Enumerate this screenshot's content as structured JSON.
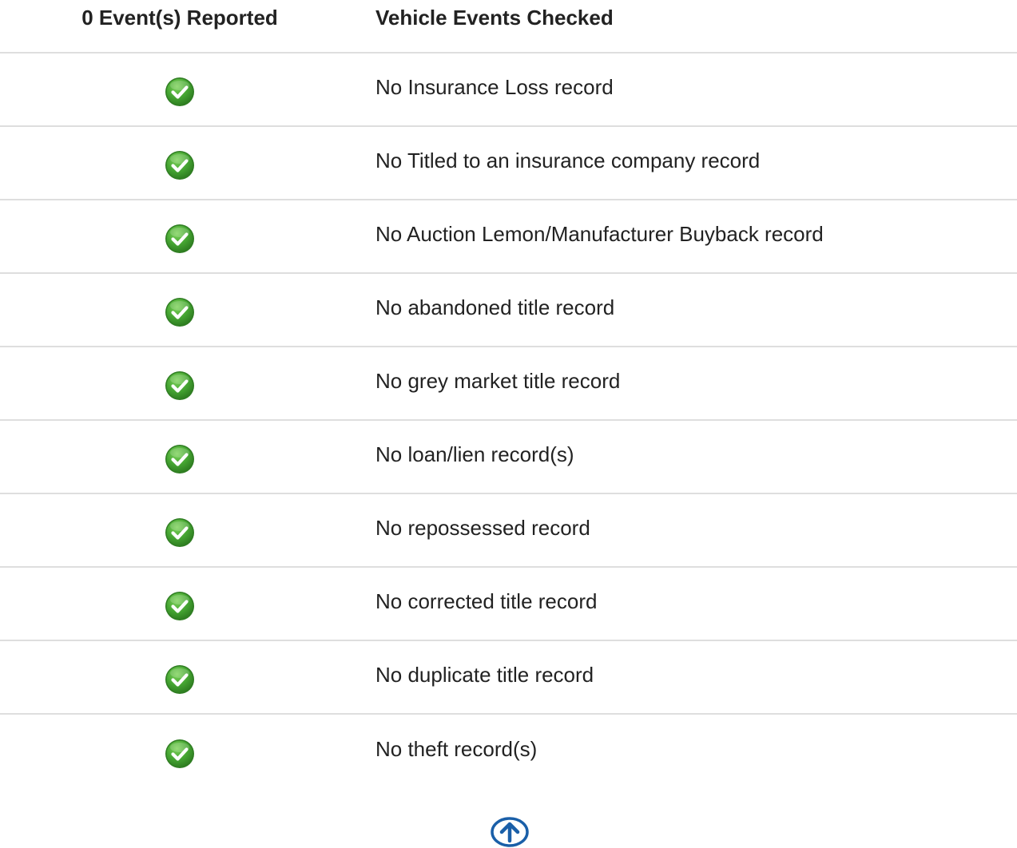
{
  "header": {
    "status_col": "0 Event(s) Reported",
    "event_col": "Vehicle Events Checked"
  },
  "rows": [
    {
      "status_icon": "green-check-icon",
      "label": "No Insurance Loss record"
    },
    {
      "status_icon": "green-check-icon",
      "label": "No Titled to an insurance company record"
    },
    {
      "status_icon": "green-check-icon",
      "label": "No Auction Lemon/Manufacturer Buyback record"
    },
    {
      "status_icon": "green-check-icon",
      "label": "No abandoned title record"
    },
    {
      "status_icon": "green-check-icon",
      "label": "No grey market title record"
    },
    {
      "status_icon": "green-check-icon",
      "label": "No loan/lien record(s)"
    },
    {
      "status_icon": "green-check-icon",
      "label": "No repossessed record"
    },
    {
      "status_icon": "green-check-icon",
      "label": "No corrected title record"
    },
    {
      "status_icon": "green-check-icon",
      "label": "No duplicate title record"
    },
    {
      "status_icon": "green-check-icon",
      "label": "No theft record(s)"
    }
  ],
  "back_to_top": {
    "icon": "arrow-up-circle-icon"
  },
  "colors": {
    "check_green": "#3e9a2b",
    "check_green_light": "#6cc24a",
    "back_to_top_blue": "#1a5fa8",
    "divider": "#dedede",
    "text": "#222222"
  }
}
